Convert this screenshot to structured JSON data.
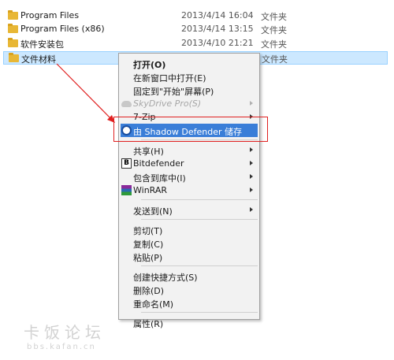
{
  "files": [
    {
      "name": "Program Files",
      "date": "2013/4/14 16:04",
      "type": "文件夹",
      "selected": false
    },
    {
      "name": "Program Files (x86)",
      "date": "2013/4/14 13:15",
      "type": "文件夹",
      "selected": false
    },
    {
      "name": "软件安装包",
      "date": "2013/4/10 21:21",
      "type": "文件夹",
      "selected": false
    },
    {
      "name": "文件材料",
      "date": "",
      "type": "文件夹",
      "selected": true
    }
  ],
  "context_menu": {
    "items": [
      {
        "label": "打开(O)",
        "bold": true
      },
      {
        "label": "在新窗口中打开(E)"
      },
      {
        "label": "固定到\"开始\"屏幕(P)"
      },
      {
        "label": "SkyDrive Pro(S)",
        "disabled": true,
        "submenu": true,
        "icon": "skydrive-icon"
      },
      {
        "label": "7-Zip",
        "submenu": true
      },
      {
        "label": "由 Shadow Defender 储存",
        "highlighted": true,
        "icon": "shadow-defender-icon"
      },
      {
        "separator": true
      },
      {
        "label": "共享(H)",
        "submenu": true
      },
      {
        "label": "Bitdefender",
        "submenu": true,
        "icon": "bitdefender-icon",
        "icon_text": "B"
      },
      {
        "label": "包含到库中(I)",
        "submenu": true
      },
      {
        "label": "WinRAR",
        "submenu": true,
        "icon": "winrar-icon"
      },
      {
        "separator": true
      },
      {
        "label": "发送到(N)",
        "submenu": true
      },
      {
        "separator": true
      },
      {
        "label": "剪切(T)"
      },
      {
        "label": "复制(C)"
      },
      {
        "label": "粘贴(P)"
      },
      {
        "separator": true
      },
      {
        "label": "创建快捷方式(S)"
      },
      {
        "label": "删除(D)"
      },
      {
        "label": "重命名(M)"
      },
      {
        "separator": true
      },
      {
        "label": "属性(R)"
      }
    ]
  },
  "watermark": {
    "title": "卡饭论坛",
    "url": "bbs.kafan.cn"
  },
  "colors": {
    "annotation": "#e02020",
    "highlight": "#3a7ed8",
    "selection": "#cce8ff"
  }
}
